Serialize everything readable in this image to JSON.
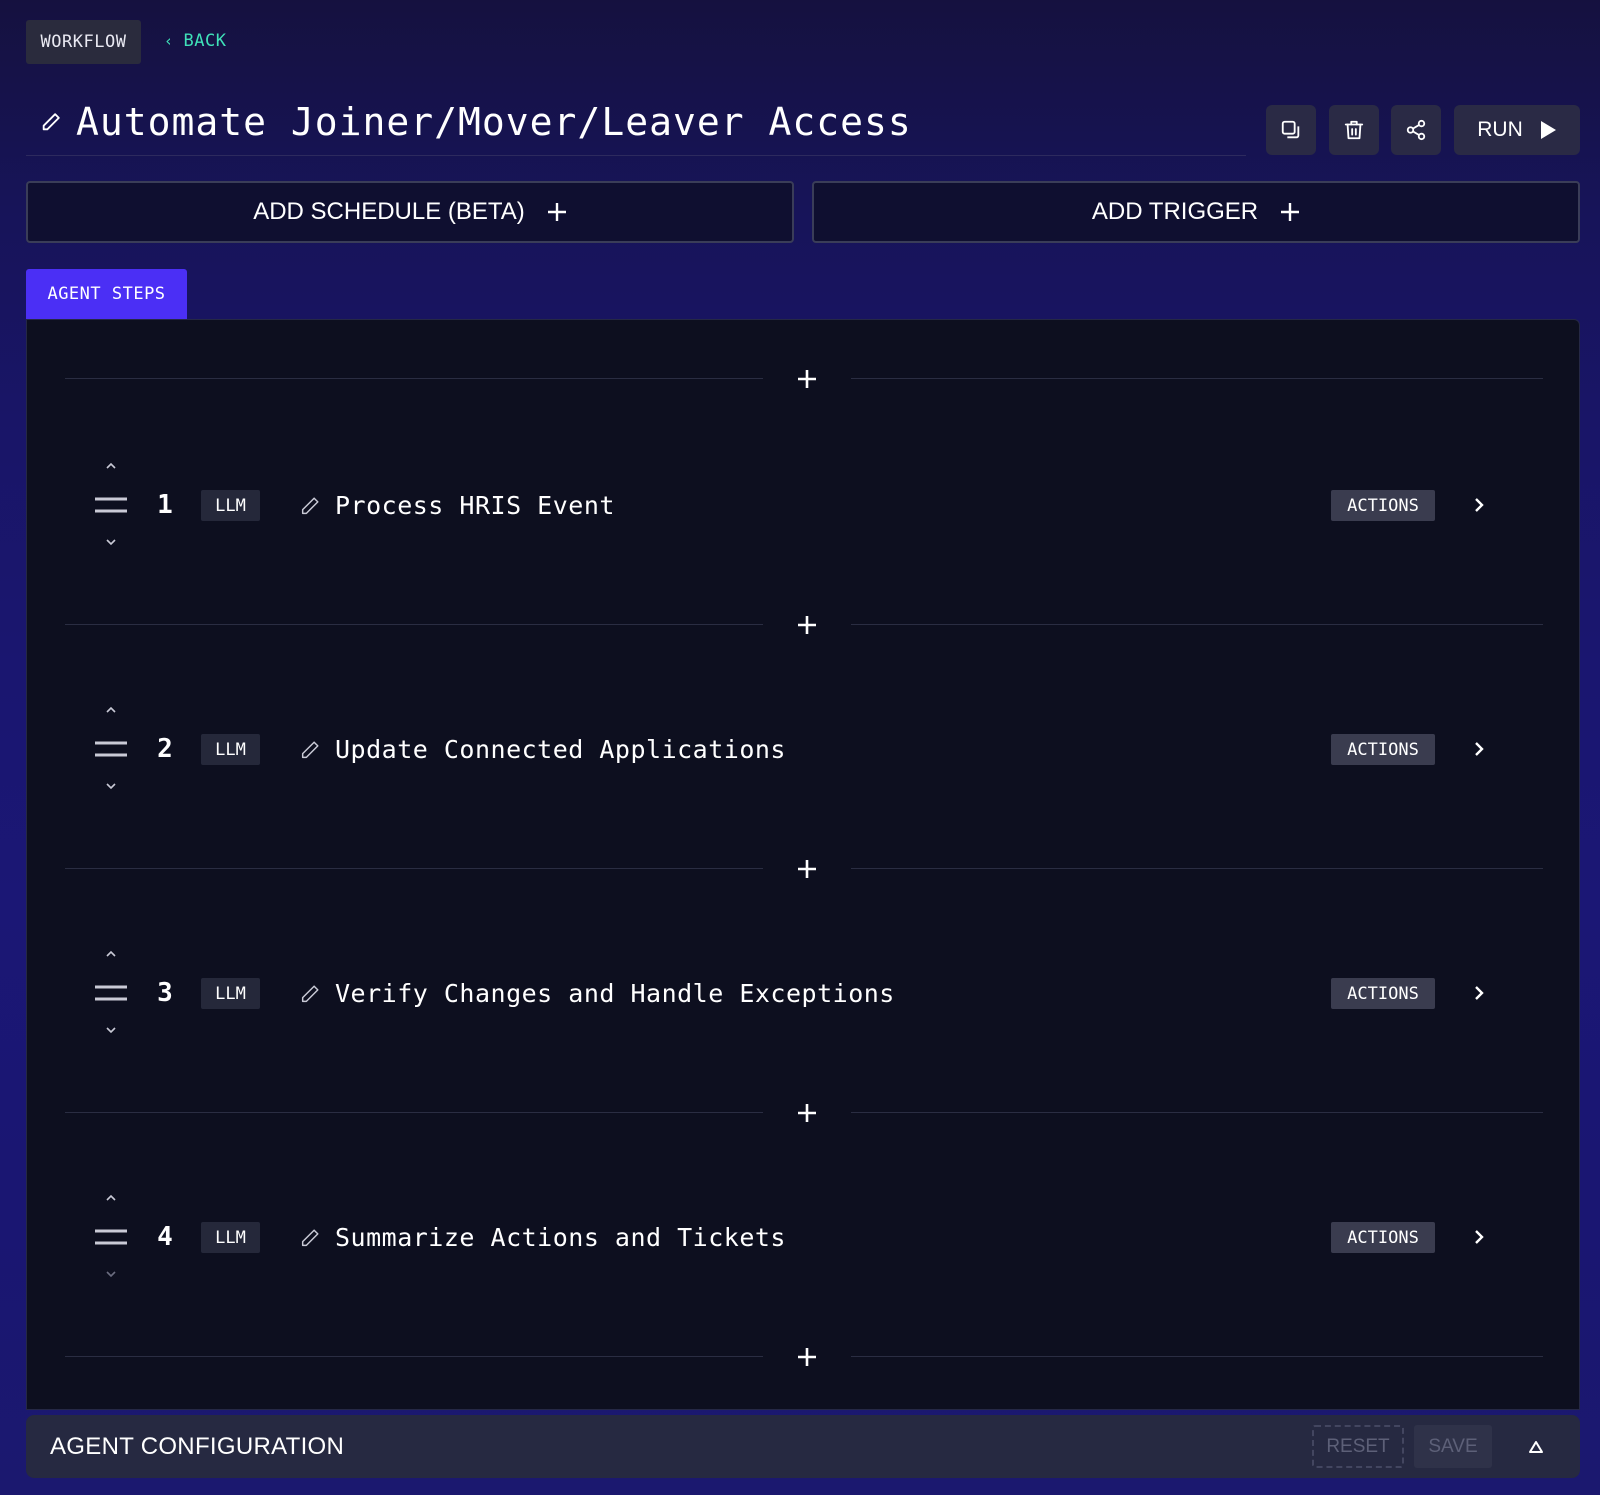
{
  "header": {
    "workflow_label": "WORKFLOW",
    "back_label": "BACK",
    "title": "Automate Joiner/Mover/Leaver Access",
    "run_label": "RUN"
  },
  "schedule": {
    "add_schedule_label": "ADD SCHEDULE (BETA)",
    "add_trigger_label": "ADD TRIGGER"
  },
  "tabs": {
    "agent_steps_label": "AGENT STEPS"
  },
  "steps": [
    {
      "number": "1",
      "type": "LLM",
      "title": "Process HRIS Event",
      "actions_label": "ACTIONS"
    },
    {
      "number": "2",
      "type": "LLM",
      "title": "Update Connected Applications",
      "actions_label": "ACTIONS"
    },
    {
      "number": "3",
      "type": "LLM",
      "title": "Verify Changes and Handle Exceptions",
      "actions_label": "ACTIONS"
    },
    {
      "number": "4",
      "type": "LLM",
      "title": "Summarize Actions and Tickets",
      "actions_label": "ACTIONS"
    }
  ],
  "config": {
    "title": "AGENT CONFIGURATION",
    "reset_label": "RESET",
    "save_label": "SAVE"
  },
  "colors": {
    "accent": "#4b2ff5",
    "back_link": "#3fe0b8",
    "panel_bg": "#0d0f1f"
  }
}
